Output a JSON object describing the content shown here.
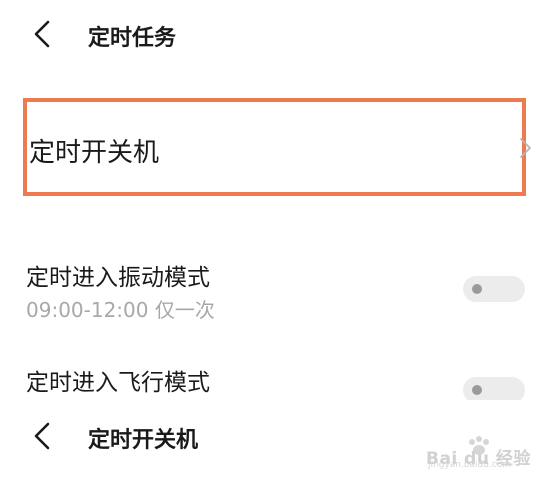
{
  "header": {
    "title": "定时任务",
    "back_icon": "chevron-left-icon"
  },
  "highlighted_item": {
    "title": "定时开关机",
    "chevron_icon": "chevron-right-icon",
    "highlight_color": "#ee7a4f"
  },
  "rows": [
    {
      "title": "定时进入振动模式",
      "subtitle": "09:00-12:00 仅一次",
      "toggle_on": false
    },
    {
      "title": "定时进入飞行模式",
      "subtitle": "",
      "toggle_on": false
    }
  ],
  "overlay": {
    "title": "定时开关机",
    "back_icon": "chevron-left-icon"
  },
  "watermark": {
    "text": "Bai du 经验",
    "url": "jingyan.baidu.com"
  }
}
